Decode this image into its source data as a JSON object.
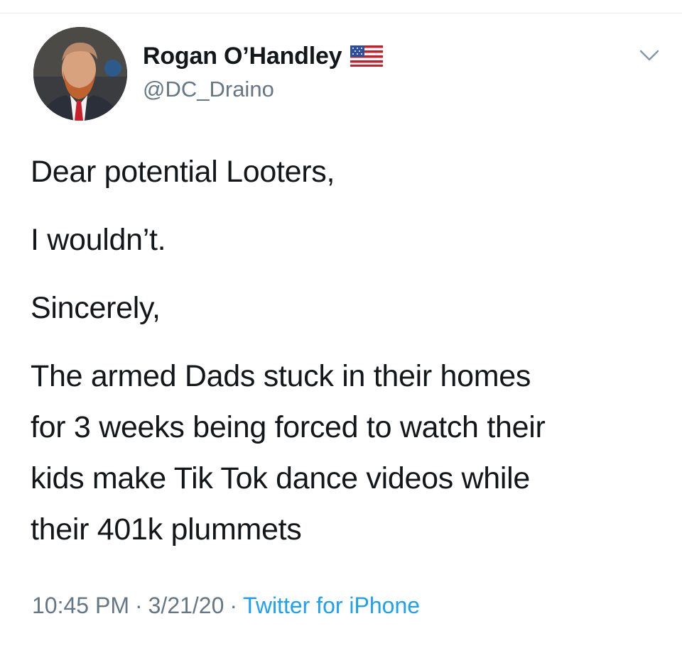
{
  "tweet": {
    "author": {
      "display_name": "Rogan O’Handley",
      "handle": "@DC_Draino",
      "badge_icon": "us-flag-icon"
    },
    "menu_icon": "chevron-down-icon",
    "paragraphs": [
      "Dear potential Looters,",
      "I wouldn’t.",
      "Sincerely,",
      "The armed Dads stuck in their homes\nfor 3 weeks being forced to watch their\nkids make Tik Tok dance videos while\ntheir 401k plummets"
    ],
    "time": "10:45 PM",
    "separator": "·",
    "date": "3/21/20",
    "source": "Twitter for iPhone"
  },
  "colors": {
    "text": "#14171a",
    "secondary": "#657786",
    "link": "#1da1f2",
    "divider": "#e6ecf0"
  }
}
